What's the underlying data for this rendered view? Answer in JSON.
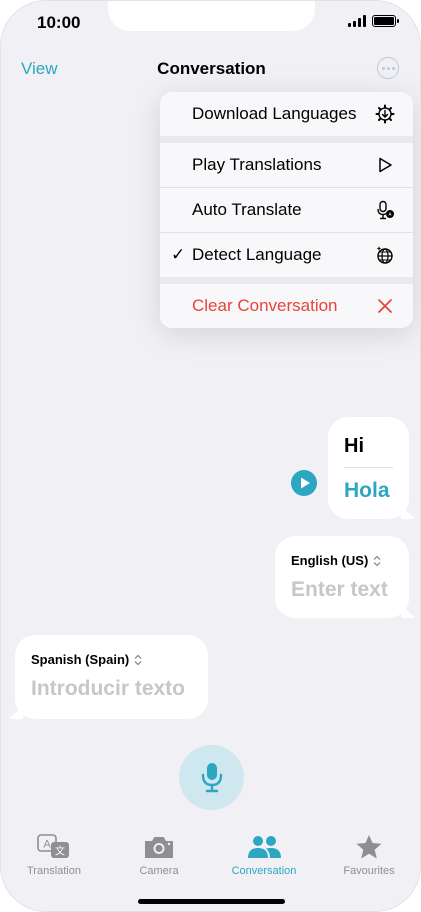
{
  "status": {
    "time": "10:00"
  },
  "nav": {
    "left": "View",
    "title": "Conversation"
  },
  "menu": {
    "items": [
      {
        "label": "Download Languages",
        "icon": "gear-download-icon"
      },
      {
        "label": "Play Translations",
        "icon": "play-outline-icon"
      },
      {
        "label": "Auto Translate",
        "icon": "mic-auto-icon"
      },
      {
        "label": "Detect Language",
        "icon": "globe-sparkle-icon",
        "checked": true
      },
      {
        "label": "Clear Conversation",
        "icon": "close-icon"
      }
    ],
    "check": "✓"
  },
  "conversation": {
    "source_text": "Hi",
    "translated_text": "Hola"
  },
  "input_en": {
    "language": "English (US)",
    "placeholder": "Enter text"
  },
  "input_es": {
    "language": "Spanish (Spain)",
    "placeholder": "Introducir texto"
  },
  "tabs": [
    {
      "label": "Translation",
      "icon": "translation-icon"
    },
    {
      "label": "Camera",
      "icon": "camera-icon"
    },
    {
      "label": "Conversation",
      "icon": "people-icon",
      "active": true
    },
    {
      "label": "Favourites",
      "icon": "star-icon"
    }
  ],
  "colors": {
    "accent": "#2ba7c2",
    "danger": "#e8433a",
    "placeholder": "#c6c6cb"
  }
}
